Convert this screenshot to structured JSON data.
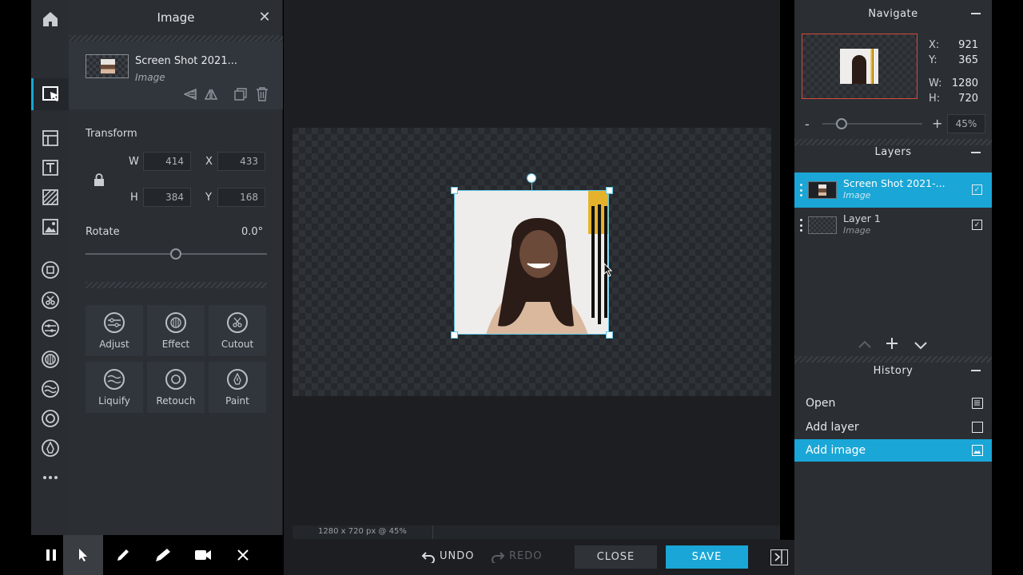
{
  "app": {
    "home_icon": "home-icon"
  },
  "panel": {
    "title": "Image",
    "layer_name": "Screen Shot 2021...",
    "layer_type": "Image",
    "transform_label": "Transform",
    "w_label": "W",
    "w_value": "414",
    "x_label": "X",
    "x_value": "433",
    "h_label": "H",
    "h_value": "384",
    "y_label": "Y",
    "y_value": "168",
    "rotate_label": "Rotate",
    "rotate_value": "0.0°",
    "effects": [
      {
        "label": "Adjust",
        "icon": "adjust-icon"
      },
      {
        "label": "Effect",
        "icon": "effect-icon"
      },
      {
        "label": "Cutout",
        "icon": "cutout-icon"
      },
      {
        "label": "Liquify",
        "icon": "liquify-icon"
      },
      {
        "label": "Retouch",
        "icon": "retouch-icon"
      },
      {
        "label": "Paint",
        "icon": "paint-icon"
      }
    ]
  },
  "workspace": {
    "status": "1280 x 720 px @ 45%"
  },
  "bottom": {
    "undo": "UNDO",
    "redo": "REDO",
    "close": "CLOSE",
    "save": "SAVE"
  },
  "navigate": {
    "title": "Navigate",
    "x_label": "X:",
    "x_value": "921",
    "y_label": "Y:",
    "y_value": "365",
    "w_label": "W:",
    "w_value": "1280",
    "h_label": "H:",
    "h_value": "720",
    "zoom_minus": "-",
    "zoom_plus": "+",
    "zoom_value": "45%"
  },
  "layers": {
    "title": "Layers",
    "items": [
      {
        "name": "Screen Shot 2021-...",
        "type": "Image"
      },
      {
        "name": "Layer 1",
        "type": "Image"
      }
    ]
  },
  "history": {
    "title": "History",
    "items": [
      {
        "label": "Open"
      },
      {
        "label": "Add layer"
      },
      {
        "label": "Add image"
      }
    ]
  },
  "colors": {
    "accent": "#1aa6d6",
    "panel_bg": "#2b2f34",
    "workspace_bg": "#1c1e21"
  }
}
